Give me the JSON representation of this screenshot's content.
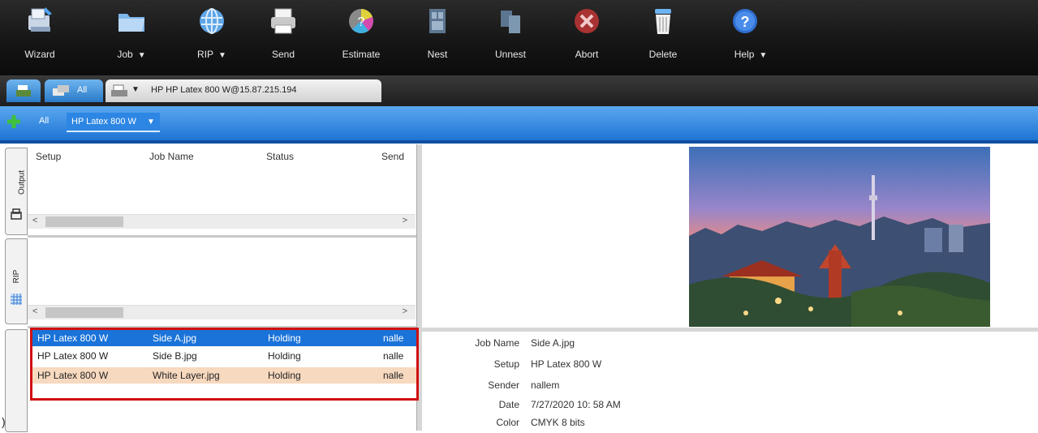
{
  "toolbar": {
    "buttons": [
      {
        "label": "Wizard",
        "icon": "wizard-icon"
      },
      {
        "label": "Job",
        "icon": "folder-icon",
        "has_dropdown": true
      },
      {
        "label": "RIP",
        "icon": "globe-icon",
        "has_dropdown": true
      },
      {
        "label": "Send",
        "icon": "printer-icon"
      },
      {
        "label": "Estimate",
        "icon": "color-wheel-icon"
      },
      {
        "label": "Nest",
        "icon": "nest-icon"
      },
      {
        "label": "Unnest",
        "icon": "unnest-icon"
      },
      {
        "label": "Abort",
        "icon": "abort-icon"
      },
      {
        "label": "Delete",
        "icon": "trash-icon"
      },
      {
        "label": "Help",
        "icon": "help-icon",
        "has_dropdown": true
      }
    ],
    "dropdown_caret": "▼"
  },
  "tabs": {
    "all_label": "All",
    "printer_tab": "HP HP Latex 800 W@15.87.215.194",
    "caret": "▼"
  },
  "filter": {
    "all_label": "All",
    "selected_printer": "HP Latex 800 W",
    "caret": "▼"
  },
  "side_tabs": {
    "output": "Output",
    "rip": "RIP"
  },
  "columns": {
    "setup": "Setup",
    "job_name": "Job Name",
    "status": "Status",
    "sender": "Send"
  },
  "scroll": {
    "left": "<",
    "right": ">"
  },
  "jobs": [
    {
      "setup": "HP Latex 800 W",
      "name": "Side A.jpg",
      "status": "Holding",
      "sender": "nalle",
      "state": "selected"
    },
    {
      "setup": "HP Latex 800 W",
      "name": "Side B.jpg",
      "status": "Holding",
      "sender": "nalle",
      "state": "normal"
    },
    {
      "setup": "HP Latex 800 W",
      "name": "White Layer.jpg",
      "status": "Holding",
      "sender": "nalle",
      "state": "highlighted"
    }
  ],
  "details": {
    "rows": [
      {
        "key": "Job Name",
        "value": "Side A.jpg"
      },
      {
        "key": "Setup",
        "value": "HP Latex 800 W"
      },
      {
        "key": "Sender",
        "value": "nallem"
      },
      {
        "key": "Date",
        "value": "7/27/2020 10: 58 AM"
      },
      {
        "key": "Color",
        "value": "CMYK 8 bits"
      }
    ]
  },
  "colors": {
    "selection": "#1a73d9",
    "highlight_row": "#f7d9bf",
    "annotation_box": "#d01010",
    "filter_bar": "#1f74d4"
  }
}
